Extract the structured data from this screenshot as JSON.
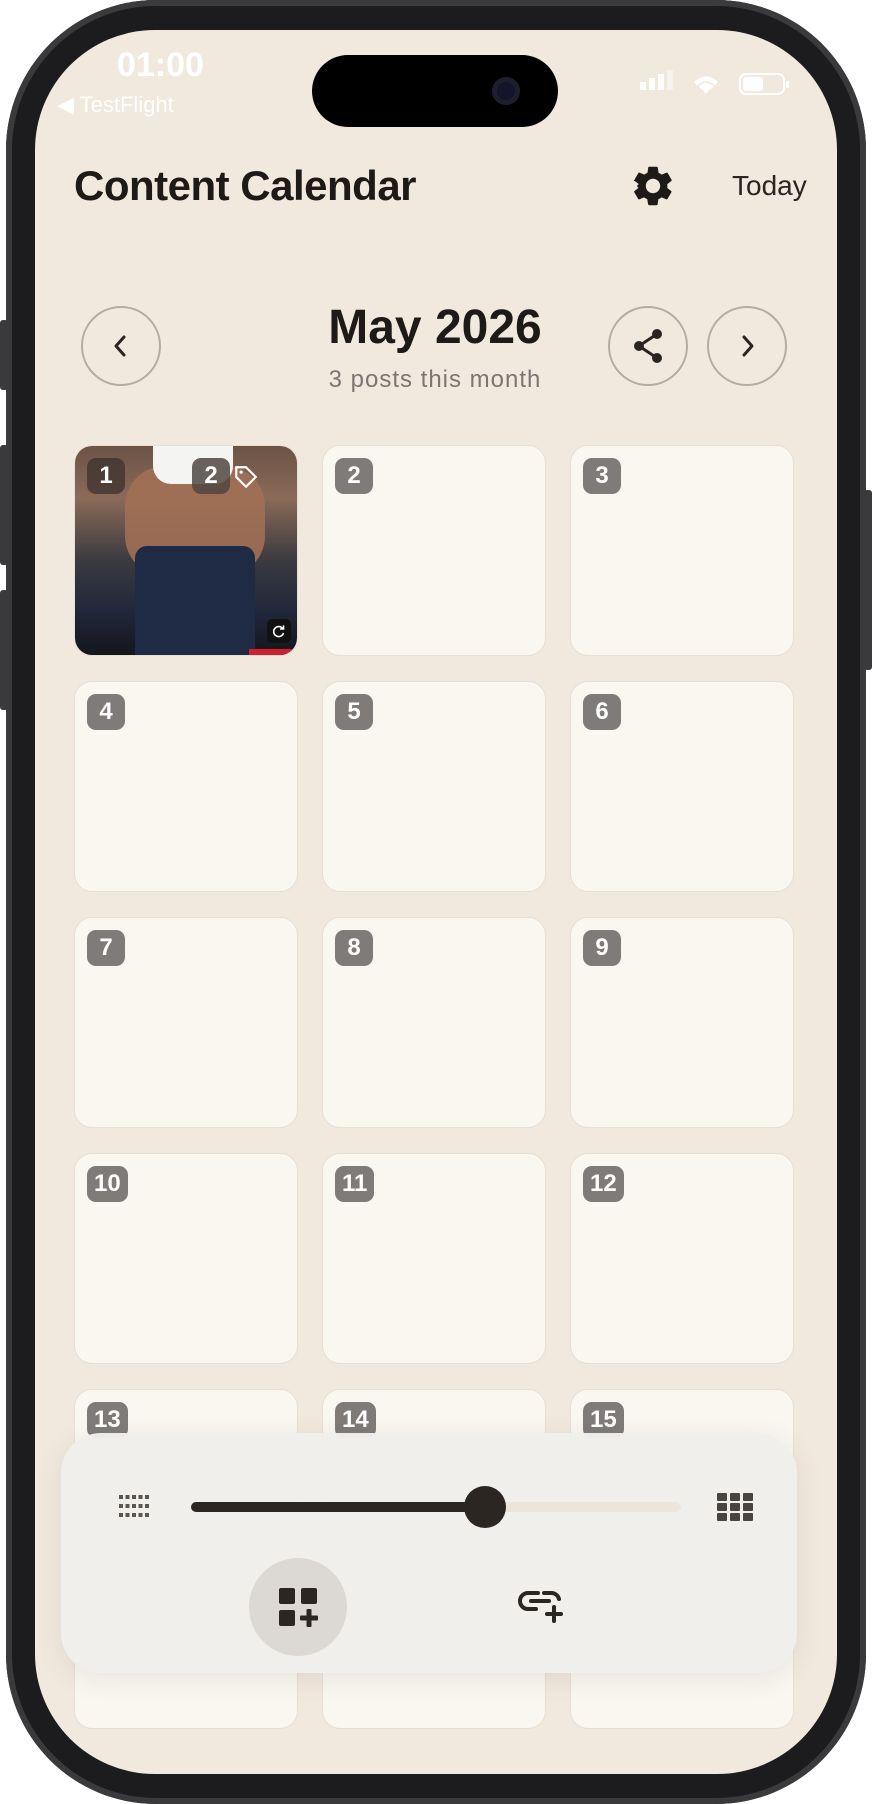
{
  "status_bar": {
    "time": "01:00",
    "back_app": "◀ TestFlight"
  },
  "header": {
    "title": "Content Calendar",
    "today_label": "Today"
  },
  "month_nav": {
    "month": "May 2026",
    "posts_summary": "3 posts this month"
  },
  "days": [
    {
      "day": "1",
      "has_post": true,
      "post_count_badge": "2"
    },
    {
      "day": "2"
    },
    {
      "day": "3"
    },
    {
      "day": "4"
    },
    {
      "day": "5"
    },
    {
      "day": "6"
    },
    {
      "day": "7"
    },
    {
      "day": "8"
    },
    {
      "day": "9"
    },
    {
      "day": "10"
    },
    {
      "day": "11"
    },
    {
      "day": "12"
    },
    {
      "day": "13"
    },
    {
      "day": "14"
    },
    {
      "day": "15"
    }
  ],
  "bottom_panel": {
    "grid_size_slider_value": 0.6,
    "icons": [
      "small-grid-icon",
      "large-grid-icon",
      "add-grid-icon",
      "add-link-icon"
    ]
  },
  "colors": {
    "background": "#f1e8de",
    "cell": "#faf6f0",
    "badge": "#7e7b78",
    "text": "#1e1a17"
  }
}
